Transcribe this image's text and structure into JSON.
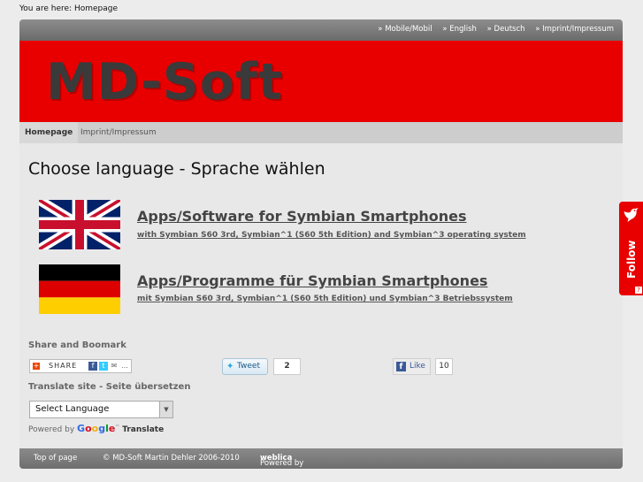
{
  "breadcrumb": "You are here: Homepage",
  "topbar": {
    "links": [
      "» Mobile/Mobil",
      "» English",
      "» Deutsch",
      "» Imprint/Impressum"
    ]
  },
  "logo": "MD-Soft",
  "nav": {
    "items": [
      "Homepage",
      "Imprint/Impressum"
    ]
  },
  "main": {
    "heading": "Choose language - Sprache wählen",
    "languages": [
      {
        "title": "Apps/Software for Symbian Smartphones",
        "subtitle": "with Symbian S60 3rd, Symbian^1 (S60 5th Edition) and Symbian^3 operating system"
      },
      {
        "title": "Apps/Programme für Symbian Smartphones",
        "subtitle": "mit Symbian S60 3rd, Symbian^1 (S60 5th Edition) und Symbian^3 Betriebssystem"
      }
    ]
  },
  "share": {
    "label": "Share and Boomark",
    "share_button": "SHARE",
    "tweet_label": "Tweet",
    "tweet_count": "2",
    "like_label": "Like",
    "like_count": "10"
  },
  "translate": {
    "label": "Translate site - Seite übersetzen",
    "select_value": "Select Language",
    "powered_prefix": "Powered by",
    "google": "Google",
    "tm": "™",
    "translate_word": "Translate"
  },
  "footer": {
    "top_of_page": "Top of page",
    "copyright": "© MD-Soft Martin Dehler 2006-2010",
    "powered_prefix": "Powered by",
    "powered_brand": "weblica"
  },
  "follow_widget": {
    "label": "Follow",
    "help": "?"
  },
  "colors": {
    "header_red": "#e80000",
    "bar_gray": "#7c7c7c",
    "background": "#ececec"
  }
}
